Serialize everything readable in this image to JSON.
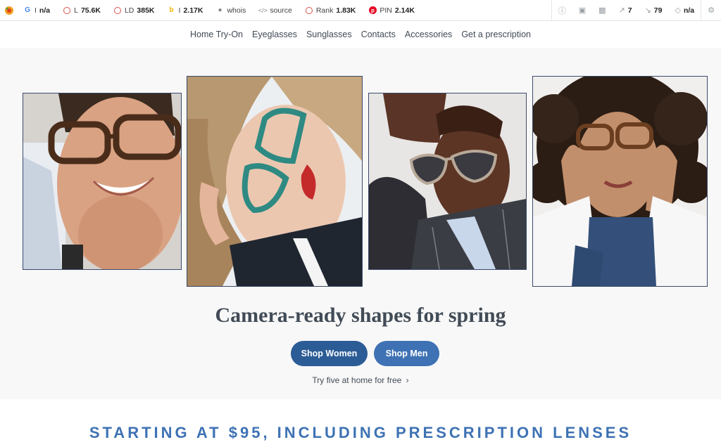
{
  "seo_bar": {
    "items": [
      {
        "icon": "google-icon",
        "label": "I",
        "value": "n/a"
      },
      {
        "icon": "circle-icon",
        "label": "L",
        "value": "75.6K"
      },
      {
        "icon": "circle-icon",
        "label": "LD",
        "value": "385K"
      },
      {
        "icon": "bing-icon",
        "label": "I",
        "value": "2.17K"
      },
      {
        "icon": "user-icon",
        "label": "whois",
        "value": ""
      },
      {
        "icon": "code-icon",
        "label": "source",
        "value": ""
      },
      {
        "icon": "circle-icon",
        "label": "Rank",
        "value": "1.83K"
      },
      {
        "icon": "pinterest-icon",
        "label": "PIN",
        "value": "2.14K"
      }
    ],
    "right": {
      "external_links": "7",
      "internal_links": "79",
      "diamond_value": "n/a"
    }
  },
  "nav": [
    "Home Try-On",
    "Eyeglasses",
    "Sunglasses",
    "Contacts",
    "Accessories",
    "Get a prescription"
  ],
  "hero": {
    "headline": "Camera-ready shapes for spring",
    "shop_women": "Shop Women",
    "shop_men": "Shop Men",
    "try_link": "Try five at home for free",
    "try_chevron": "›"
  },
  "banner": "STARTING AT $95, INCLUDING PRESCRIPTION LENSES",
  "colors": {
    "primary": "#2c5c96",
    "secondary": "#3e72b4",
    "text": "#414b56",
    "hero_bg": "#f8f8f8"
  }
}
